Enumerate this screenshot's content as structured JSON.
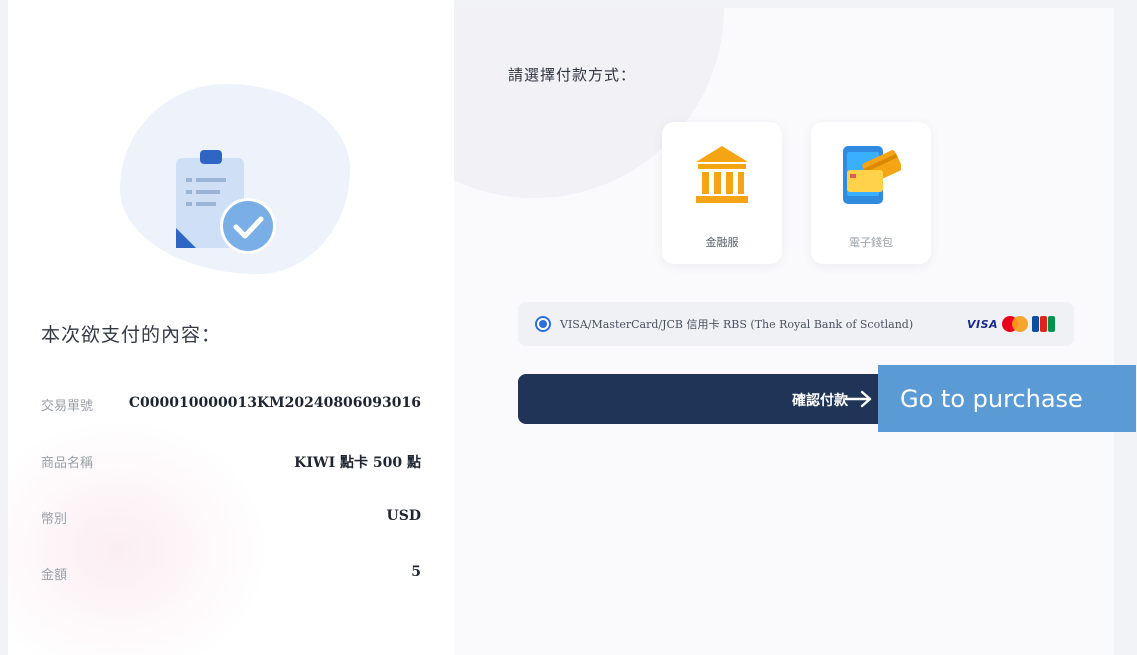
{
  "summary": {
    "title": "本次欲支付的內容：",
    "rows": [
      {
        "label": "交易單號",
        "value": "C000010000013KM20240806093016"
      },
      {
        "label": "商品名稱",
        "value": "KIWI 點卡 500 點"
      },
      {
        "label": "幣別",
        "value": "USD"
      },
      {
        "label": "金額",
        "value": "5"
      }
    ]
  },
  "payment": {
    "title": "請選擇付款方式：",
    "methods": [
      {
        "label": "金融服",
        "icon": "bank-icon"
      },
      {
        "label": "電子錢包",
        "icon": "e-wallet-icon"
      }
    ],
    "option": {
      "text": "VISA/MasterCard/JCB 信用卡 RBS (The Royal Bank of Scotland)",
      "selected": true,
      "brands": {
        "visa": "VISA"
      }
    },
    "confirm_label": "確認付款"
  },
  "overlay": {
    "label": "Go to purchase",
    "color": "#5b9bd5"
  },
  "colors": {
    "primary_button": "#1f3457",
    "radio": "#2c6fd8",
    "bank_gold": "#f5a413"
  }
}
